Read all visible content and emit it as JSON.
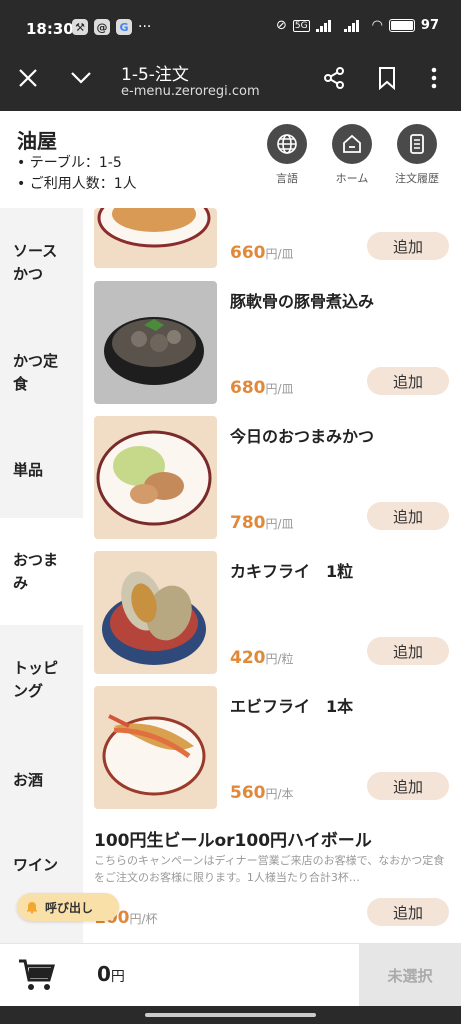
{
  "status": {
    "time": "18:30",
    "battery": "97",
    "network": "5G"
  },
  "browser": {
    "title": "1-5-注文",
    "url": "e-menu.zeroregi.com"
  },
  "restaurant": {
    "name": "油屋",
    "table": "テーブル：1-5",
    "guests": "ご利用人数：1人",
    "buttons": [
      {
        "label": "言語",
        "icon": "globe-icon"
      },
      {
        "label": "ホーム",
        "icon": "home-icon"
      },
      {
        "label": "注文履歴",
        "icon": "receipt-icon"
      }
    ]
  },
  "categories": [
    {
      "label": "ソースかつ",
      "active": false
    },
    {
      "label": "かつ定食",
      "active": false
    },
    {
      "label": "単品",
      "active": false
    },
    {
      "label": "おつまみ",
      "active": true
    },
    {
      "label": "トッピング",
      "active": false
    },
    {
      "label": "お酒",
      "active": false
    },
    {
      "label": "ワイン",
      "active": false
    }
  ],
  "items": [
    {
      "name": "",
      "price": "660",
      "unit": "円/皿",
      "add": "追加"
    },
    {
      "name": "豚軟骨の豚骨煮込み",
      "price": "680",
      "unit": "円/皿",
      "add": "追加"
    },
    {
      "name": "今日のおつまみかつ",
      "price": "780",
      "unit": "円/皿",
      "add": "追加"
    },
    {
      "name": "カキフライ　1粒",
      "price": "420",
      "unit": "円/粒",
      "add": "追加"
    },
    {
      "name": "エビフライ　1本",
      "price": "560",
      "unit": "円/本",
      "add": "追加"
    },
    {
      "name": "100円生ビールor100円ハイボール",
      "price": "100",
      "unit": "円/杯",
      "add": "追加"
    }
  ],
  "promo_desc": "こちらのキャンペーンはディナー営業ご来店のお客様で、なおかつ定食をご注文のお客様に限ります。1人様当たり合計3杯…",
  "call_staff": "呼び出し",
  "cart": {
    "total": "0",
    "yen": "円",
    "select": "未選択"
  },
  "colors": {
    "accent": "#e0893a",
    "add_button": "#f4e3d7",
    "dark": "#2a2a2a"
  }
}
